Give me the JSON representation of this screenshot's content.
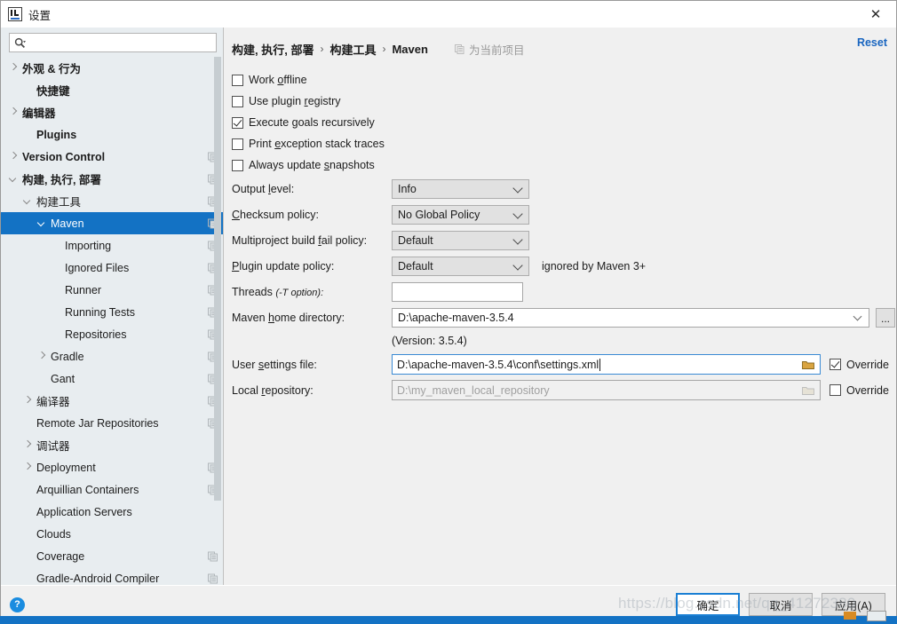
{
  "window": {
    "title": "设置",
    "logo_icon": "intellij-idea-logo-icon",
    "close_icon": "close-icon"
  },
  "sidebar": {
    "search": {
      "placeholder": "",
      "value": "",
      "icon": "search-icon"
    },
    "items": [
      {
        "label": "外观 & 行为",
        "indent": 0,
        "arrow": "right",
        "bold": true,
        "copy": false,
        "selected": false
      },
      {
        "label": "快捷键",
        "indent": 1,
        "arrow": "none",
        "bold": true,
        "copy": false,
        "selected": false
      },
      {
        "label": "编辑器",
        "indent": 0,
        "arrow": "right",
        "bold": true,
        "copy": false,
        "selected": false
      },
      {
        "label": "Plugins",
        "indent": 1,
        "arrow": "none",
        "bold": true,
        "copy": false,
        "selected": false
      },
      {
        "label": "Version Control",
        "indent": 0,
        "arrow": "right",
        "bold": true,
        "copy": true,
        "selected": false
      },
      {
        "label": "构建, 执行, 部署",
        "indent": 0,
        "arrow": "down",
        "bold": true,
        "copy": true,
        "selected": false
      },
      {
        "label": "构建工具",
        "indent": 1,
        "arrow": "down",
        "bold": false,
        "copy": true,
        "selected": false
      },
      {
        "label": "Maven",
        "indent": 2,
        "arrow": "down",
        "bold": false,
        "copy": true,
        "selected": true
      },
      {
        "label": "Importing",
        "indent": 3,
        "arrow": "none",
        "bold": false,
        "copy": true,
        "selected": false
      },
      {
        "label": "Ignored Files",
        "indent": 3,
        "arrow": "none",
        "bold": false,
        "copy": true,
        "selected": false
      },
      {
        "label": "Runner",
        "indent": 3,
        "arrow": "none",
        "bold": false,
        "copy": true,
        "selected": false
      },
      {
        "label": "Running Tests",
        "indent": 3,
        "arrow": "none",
        "bold": false,
        "copy": true,
        "selected": false
      },
      {
        "label": "Repositories",
        "indent": 3,
        "arrow": "none",
        "bold": false,
        "copy": true,
        "selected": false
      },
      {
        "label": "Gradle",
        "indent": 2,
        "arrow": "right",
        "bold": false,
        "copy": true,
        "selected": false
      },
      {
        "label": "Gant",
        "indent": 2,
        "arrow": "none",
        "bold": false,
        "copy": true,
        "selected": false
      },
      {
        "label": "编译器",
        "indent": 1,
        "arrow": "right",
        "bold": false,
        "copy": true,
        "selected": false
      },
      {
        "label": "Remote Jar Repositories",
        "indent": 1,
        "arrow": "none",
        "bold": false,
        "copy": true,
        "selected": false
      },
      {
        "label": "调试器",
        "indent": 1,
        "arrow": "right",
        "bold": false,
        "copy": false,
        "selected": false
      },
      {
        "label": "Deployment",
        "indent": 1,
        "arrow": "right",
        "bold": false,
        "copy": true,
        "selected": false
      },
      {
        "label": "Arquillian Containers",
        "indent": 1,
        "arrow": "none",
        "bold": false,
        "copy": true,
        "selected": false
      },
      {
        "label": "Application Servers",
        "indent": 1,
        "arrow": "none",
        "bold": false,
        "copy": false,
        "selected": false
      },
      {
        "label": "Clouds",
        "indent": 1,
        "arrow": "none",
        "bold": false,
        "copy": false,
        "selected": false
      },
      {
        "label": "Coverage",
        "indent": 1,
        "arrow": "none",
        "bold": false,
        "copy": true,
        "selected": false
      },
      {
        "label": "Gradle-Android Compiler",
        "indent": 1,
        "arrow": "none",
        "bold": false,
        "copy": true,
        "selected": false
      }
    ]
  },
  "header": {
    "breadcrumb": [
      "构建, 执行, 部署",
      "构建工具",
      "Maven"
    ],
    "separator": "›",
    "project_scope_label": "为当前项目",
    "project_scope_icon": "copy-icon",
    "reset_label": "Reset"
  },
  "main": {
    "checkboxes": [
      {
        "label_pre": "Work ",
        "label_mn": "o",
        "label_post": "ffline",
        "checked": false
      },
      {
        "label_pre": "Use plugin ",
        "label_mn": "r",
        "label_post": "egistry",
        "checked": false
      },
      {
        "label_pre": "Execute ",
        "label_mn": "g",
        "label_post": "oals recursively",
        "checked": true
      },
      {
        "label_pre": "Print ",
        "label_mn": "e",
        "label_post": "xception stack traces",
        "checked": false
      },
      {
        "label_pre": "Always update ",
        "label_mn": "s",
        "label_post": "napshots",
        "checked": false
      }
    ],
    "output_level": {
      "label_pre": "Output ",
      "label_mn": "l",
      "label_post": "evel:",
      "value": "Info"
    },
    "checksum_policy": {
      "label_pre": "",
      "label_mn": "C",
      "label_post": "hecksum policy:",
      "value": "No Global Policy"
    },
    "multiproject_policy": {
      "label_pre": "Multiproject build ",
      "label_mn": "f",
      "label_post": "ail policy:",
      "value": "Default"
    },
    "plugin_update_policy": {
      "label_pre": "",
      "label_mn": "P",
      "label_post": "lugin update policy:",
      "value": "Default",
      "note": "ignored by Maven 3+"
    },
    "threads": {
      "label": "Threads",
      "label_hint": "(-T option):",
      "value": "",
      "placeholder": ""
    },
    "maven_home": {
      "label_pre": "Maven ",
      "label_mn": "h",
      "label_post": "ome directory:",
      "value": "D:\\apache-maven-3.5.4",
      "browse_label": "...",
      "version_text": "(Version: 3.5.4)"
    },
    "user_settings": {
      "label_pre": "User ",
      "label_mn": "s",
      "label_post": "ettings file:",
      "value": "D:\\apache-maven-3.5.4\\conf\\settings.xml",
      "override_label": "Override",
      "override_checked": true,
      "focused": true
    },
    "local_repository": {
      "label_pre": "Local ",
      "label_mn": "r",
      "label_post": "epository:",
      "value": "D:\\my_maven_local_repository",
      "override_label": "Override",
      "override_checked": false,
      "disabled": true
    }
  },
  "footer": {
    "help_icon": "help-icon",
    "help_glyph": "?",
    "ok_label": "确定",
    "cancel_label": "取消",
    "apply_label": "应用(A)"
  },
  "watermark": {
    "text": "https://blog.csdn.net/qq_41272380"
  },
  "colors": {
    "accent_blue": "#1372c4",
    "link_blue": "#1a66c0",
    "sidebar_bg": "#e8edf0",
    "panel_bg": "#f0f0f0",
    "focus_border": "#3a8ad4"
  }
}
